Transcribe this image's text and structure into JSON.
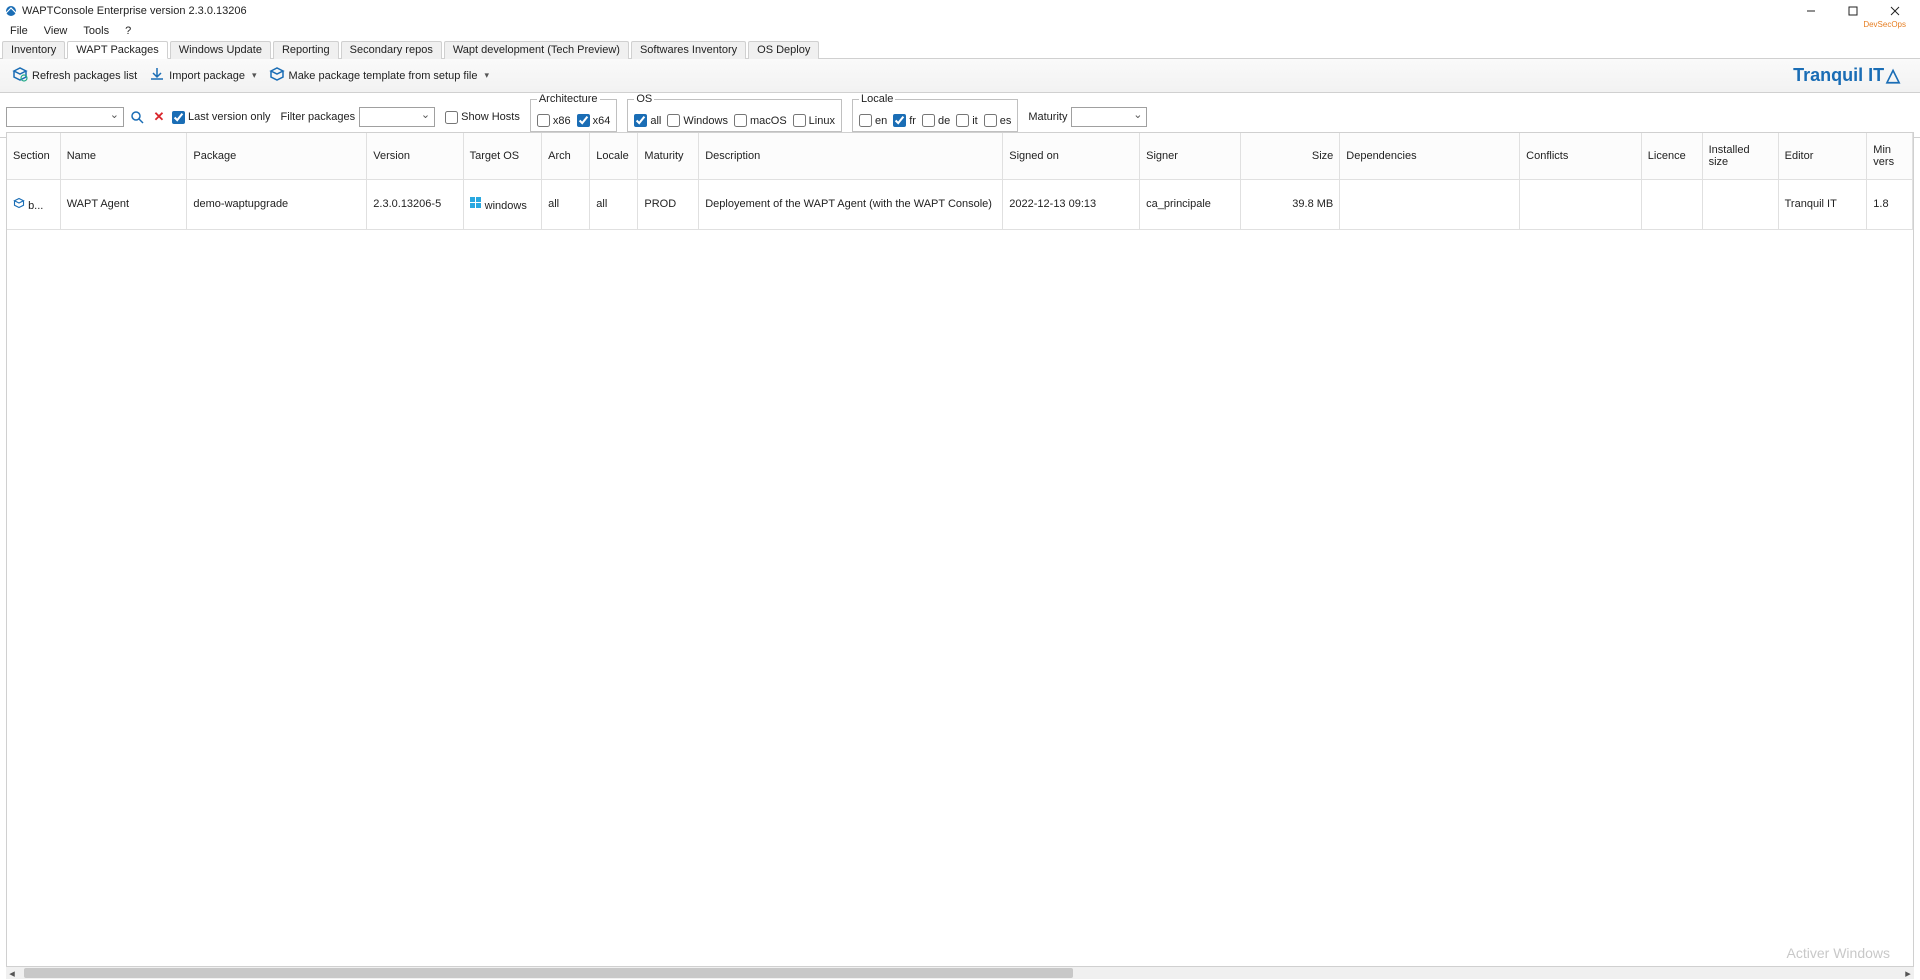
{
  "window": {
    "title": "WAPTConsole Enterprise version 2.3.0.13206"
  },
  "menu": {
    "file": "File",
    "view": "View",
    "tools": "Tools",
    "help": "?"
  },
  "tabs": {
    "inventory": "Inventory",
    "wapt_packages": "WAPT Packages",
    "windows_update": "Windows Update",
    "reporting": "Reporting",
    "secondary_repos": "Secondary repos",
    "wapt_dev": "Wapt development (Tech Preview)",
    "softwares_inventory": "Softwares Inventory",
    "os_deploy": "OS Deploy"
  },
  "toolbar": {
    "refresh": "Refresh packages list",
    "import": "Import package",
    "make_template": "Make package template from setup file"
  },
  "brand": {
    "name": "Tranquil IT",
    "sub": "DevSecOps"
  },
  "filters": {
    "last_version_only": "Last version only",
    "filter_packages": "Filter packages",
    "show_hosts": "Show Hosts",
    "architecture": {
      "label": "Architecture",
      "x86": "x86",
      "x64": "x64"
    },
    "os": {
      "label": "OS",
      "all": "all",
      "windows": "Windows",
      "macos": "macOS",
      "linux": "Linux"
    },
    "locale": {
      "label": "Locale",
      "en": "en",
      "fr": "fr",
      "de": "de",
      "it": "it",
      "es": "es"
    },
    "maturity": "Maturity"
  },
  "table": {
    "headers": {
      "section": "Section",
      "name": "Name",
      "package": "Package",
      "version": "Version",
      "target_os": "Target OS",
      "arch": "Arch",
      "locale": "Locale",
      "maturity": "Maturity",
      "description": "Description",
      "signed_on": "Signed on",
      "signer": "Signer",
      "size": "Size",
      "dependencies": "Dependencies",
      "conflicts": "Conflicts",
      "licence": "Licence",
      "installed_size": "Installed size",
      "editor": "Editor",
      "min_vers": "Min vers"
    },
    "rows": [
      {
        "section": "b...",
        "name": "WAPT Agent",
        "package": "demo-waptupgrade",
        "version": "2.3.0.13206-5",
        "target_os": "windows",
        "arch": "all",
        "locale": "all",
        "maturity": "PROD",
        "description": "Deployement of the WAPT Agent (with the WAPT Console)",
        "signed_on": "2022-12-13 09:13",
        "signer": "ca_principale",
        "size": "39.8 MB",
        "dependencies": "",
        "conflicts": "",
        "licence": "",
        "installed_size": "",
        "editor": "Tranquil IT",
        "min_vers": "1.8"
      }
    ]
  },
  "watermark": "Activer Windows"
}
